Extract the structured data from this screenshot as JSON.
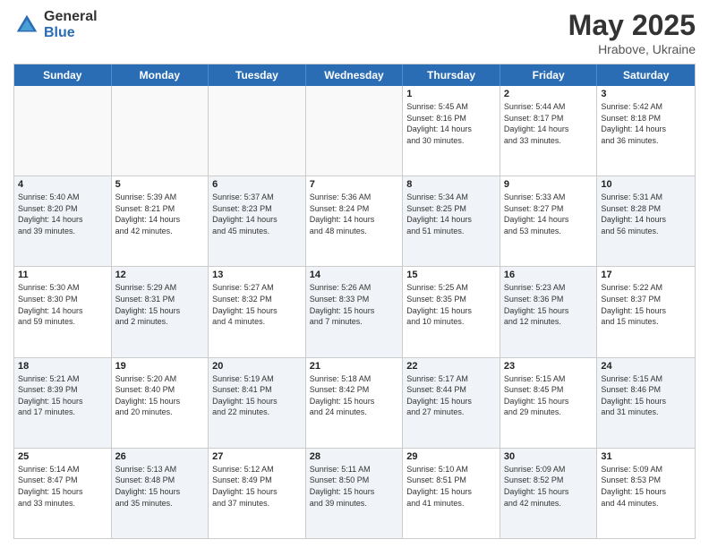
{
  "header": {
    "logo_general": "General",
    "logo_blue": "Blue",
    "title": "May 2025",
    "location": "Hrabove, Ukraine"
  },
  "weekdays": [
    "Sunday",
    "Monday",
    "Tuesday",
    "Wednesday",
    "Thursday",
    "Friday",
    "Saturday"
  ],
  "rows": [
    [
      {
        "day": "",
        "text": "",
        "empty": true
      },
      {
        "day": "",
        "text": "",
        "empty": true
      },
      {
        "day": "",
        "text": "",
        "empty": true
      },
      {
        "day": "",
        "text": "",
        "empty": true
      },
      {
        "day": "1",
        "text": "Sunrise: 5:45 AM\nSunset: 8:16 PM\nDaylight: 14 hours\nand 30 minutes."
      },
      {
        "day": "2",
        "text": "Sunrise: 5:44 AM\nSunset: 8:17 PM\nDaylight: 14 hours\nand 33 minutes."
      },
      {
        "day": "3",
        "text": "Sunrise: 5:42 AM\nSunset: 8:18 PM\nDaylight: 14 hours\nand 36 minutes."
      }
    ],
    [
      {
        "day": "4",
        "text": "Sunrise: 5:40 AM\nSunset: 8:20 PM\nDaylight: 14 hours\nand 39 minutes.",
        "shaded": true
      },
      {
        "day": "5",
        "text": "Sunrise: 5:39 AM\nSunset: 8:21 PM\nDaylight: 14 hours\nand 42 minutes."
      },
      {
        "day": "6",
        "text": "Sunrise: 5:37 AM\nSunset: 8:23 PM\nDaylight: 14 hours\nand 45 minutes.",
        "shaded": true
      },
      {
        "day": "7",
        "text": "Sunrise: 5:36 AM\nSunset: 8:24 PM\nDaylight: 14 hours\nand 48 minutes."
      },
      {
        "day": "8",
        "text": "Sunrise: 5:34 AM\nSunset: 8:25 PM\nDaylight: 14 hours\nand 51 minutes.",
        "shaded": true
      },
      {
        "day": "9",
        "text": "Sunrise: 5:33 AM\nSunset: 8:27 PM\nDaylight: 14 hours\nand 53 minutes."
      },
      {
        "day": "10",
        "text": "Sunrise: 5:31 AM\nSunset: 8:28 PM\nDaylight: 14 hours\nand 56 minutes.",
        "shaded": true
      }
    ],
    [
      {
        "day": "11",
        "text": "Sunrise: 5:30 AM\nSunset: 8:30 PM\nDaylight: 14 hours\nand 59 minutes."
      },
      {
        "day": "12",
        "text": "Sunrise: 5:29 AM\nSunset: 8:31 PM\nDaylight: 15 hours\nand 2 minutes.",
        "shaded": true
      },
      {
        "day": "13",
        "text": "Sunrise: 5:27 AM\nSunset: 8:32 PM\nDaylight: 15 hours\nand 4 minutes."
      },
      {
        "day": "14",
        "text": "Sunrise: 5:26 AM\nSunset: 8:33 PM\nDaylight: 15 hours\nand 7 minutes.",
        "shaded": true
      },
      {
        "day": "15",
        "text": "Sunrise: 5:25 AM\nSunset: 8:35 PM\nDaylight: 15 hours\nand 10 minutes."
      },
      {
        "day": "16",
        "text": "Sunrise: 5:23 AM\nSunset: 8:36 PM\nDaylight: 15 hours\nand 12 minutes.",
        "shaded": true
      },
      {
        "day": "17",
        "text": "Sunrise: 5:22 AM\nSunset: 8:37 PM\nDaylight: 15 hours\nand 15 minutes."
      }
    ],
    [
      {
        "day": "18",
        "text": "Sunrise: 5:21 AM\nSunset: 8:39 PM\nDaylight: 15 hours\nand 17 minutes.",
        "shaded": true
      },
      {
        "day": "19",
        "text": "Sunrise: 5:20 AM\nSunset: 8:40 PM\nDaylight: 15 hours\nand 20 minutes."
      },
      {
        "day": "20",
        "text": "Sunrise: 5:19 AM\nSunset: 8:41 PM\nDaylight: 15 hours\nand 22 minutes.",
        "shaded": true
      },
      {
        "day": "21",
        "text": "Sunrise: 5:18 AM\nSunset: 8:42 PM\nDaylight: 15 hours\nand 24 minutes."
      },
      {
        "day": "22",
        "text": "Sunrise: 5:17 AM\nSunset: 8:44 PM\nDaylight: 15 hours\nand 27 minutes.",
        "shaded": true
      },
      {
        "day": "23",
        "text": "Sunrise: 5:15 AM\nSunset: 8:45 PM\nDaylight: 15 hours\nand 29 minutes."
      },
      {
        "day": "24",
        "text": "Sunrise: 5:15 AM\nSunset: 8:46 PM\nDaylight: 15 hours\nand 31 minutes.",
        "shaded": true
      }
    ],
    [
      {
        "day": "25",
        "text": "Sunrise: 5:14 AM\nSunset: 8:47 PM\nDaylight: 15 hours\nand 33 minutes."
      },
      {
        "day": "26",
        "text": "Sunrise: 5:13 AM\nSunset: 8:48 PM\nDaylight: 15 hours\nand 35 minutes.",
        "shaded": true
      },
      {
        "day": "27",
        "text": "Sunrise: 5:12 AM\nSunset: 8:49 PM\nDaylight: 15 hours\nand 37 minutes."
      },
      {
        "day": "28",
        "text": "Sunrise: 5:11 AM\nSunset: 8:50 PM\nDaylight: 15 hours\nand 39 minutes.",
        "shaded": true
      },
      {
        "day": "29",
        "text": "Sunrise: 5:10 AM\nSunset: 8:51 PM\nDaylight: 15 hours\nand 41 minutes."
      },
      {
        "day": "30",
        "text": "Sunrise: 5:09 AM\nSunset: 8:52 PM\nDaylight: 15 hours\nand 42 minutes.",
        "shaded": true
      },
      {
        "day": "31",
        "text": "Sunrise: 5:09 AM\nSunset: 8:53 PM\nDaylight: 15 hours\nand 44 minutes."
      }
    ]
  ]
}
